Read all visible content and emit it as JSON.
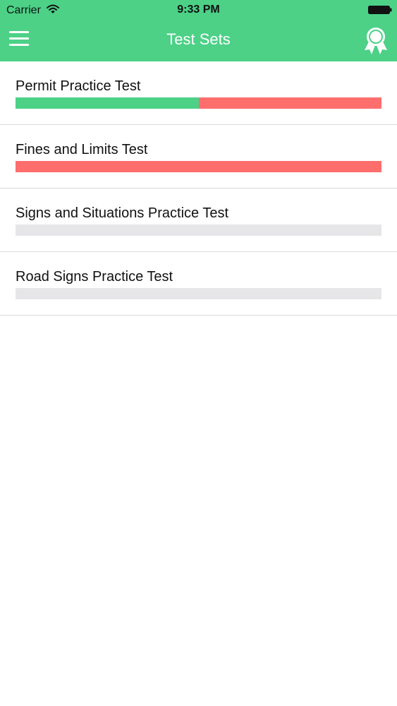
{
  "status_bar": {
    "carrier": "Carrier",
    "time": "9:33 PM",
    "icons": [
      "wifi-icon",
      "battery-icon"
    ]
  },
  "nav": {
    "title": "Test Sets",
    "left_icon": "menu-icon",
    "right_icon": "award-ribbon-icon"
  },
  "colors": {
    "header": "#4cd187",
    "correct": "#4cd187",
    "incorrect": "#fd6e6d",
    "unanswered": "#e6e6e8"
  },
  "tests": [
    {
      "name": "Permit Practice Test",
      "correct_fraction": 0.5,
      "incorrect_fraction": 0.5
    },
    {
      "name": "Fines and Limits Test",
      "correct_fraction": 0.0,
      "incorrect_fraction": 1.0
    },
    {
      "name": "Signs and Situations Practice Test",
      "correct_fraction": 0.0,
      "incorrect_fraction": 0.0
    },
    {
      "name": "Road Signs Practice Test",
      "correct_fraction": 0.0,
      "incorrect_fraction": 0.0
    }
  ]
}
